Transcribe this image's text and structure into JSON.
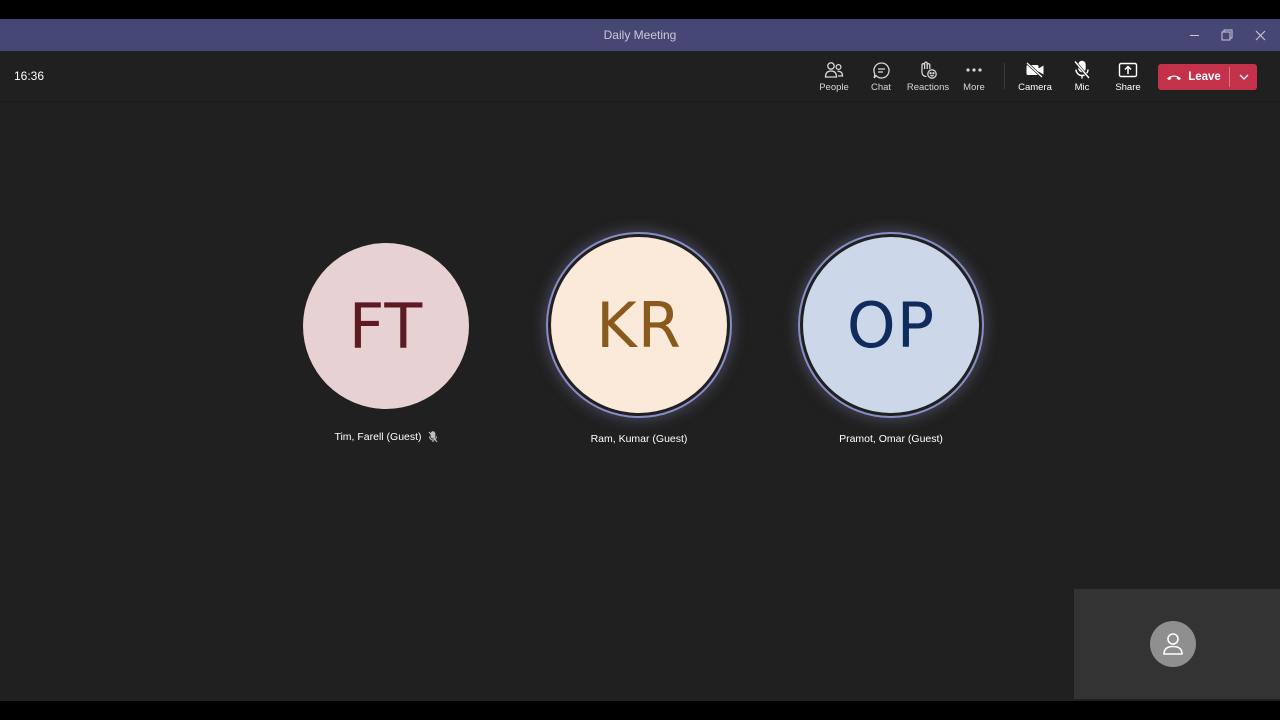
{
  "window": {
    "title": "Daily Meeting",
    "controls": [
      "minimize-icon",
      "restore-icon",
      "close-icon"
    ]
  },
  "toolbar": {
    "clock": "16:36",
    "buttons": [
      {
        "label": "People",
        "icon": "people-icon"
      },
      {
        "label": "Chat",
        "icon": "chat-icon"
      },
      {
        "label": "Reactions",
        "icon": "reactions-icon"
      },
      {
        "label": "More",
        "icon": "more-icon"
      },
      {
        "label": "Camera",
        "icon": "camera-off-icon"
      },
      {
        "label": "Mic",
        "icon": "mic-off-icon"
      },
      {
        "label": "Share",
        "icon": "share-icon"
      }
    ],
    "leave": {
      "label": "Leave",
      "icon": "phone-hangup-icon",
      "color": "#c4314b"
    }
  },
  "participants": [
    {
      "initials": "FT",
      "name": "Tim, Farell (Guest)",
      "muted": true,
      "speaking": false,
      "bg": "#e8d1d3",
      "fg": "#5c1a22"
    },
    {
      "initials": "KR",
      "name": "Ram, Kumar (Guest)",
      "muted": false,
      "speaking": true,
      "bg": "#fbe9d9",
      "fg": "#8a5a1c"
    },
    {
      "initials": "OP",
      "name": "Pramot, Omar (Guest)",
      "muted": false,
      "speaking": true,
      "bg": "#ccd8ea",
      "fg": "#0f2c5c"
    }
  ],
  "colors": {
    "titlebar": "#464775",
    "stage": "#202020",
    "speaking_ring": "#8b8cc7",
    "self_view": "#333333"
  }
}
